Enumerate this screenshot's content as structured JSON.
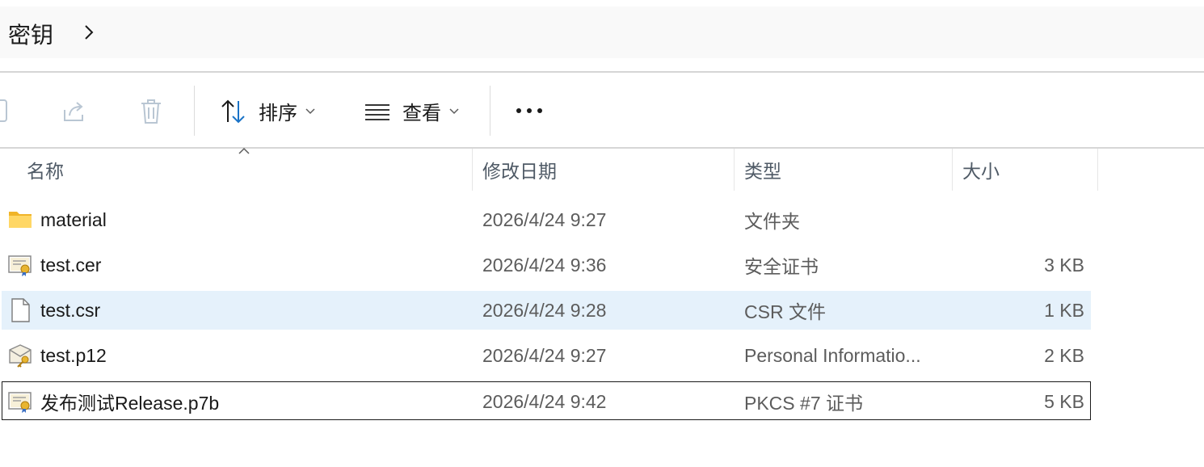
{
  "address_bar": {
    "crumb": "密钥",
    "separator_icon": "chevron-right-icon"
  },
  "toolbar": {
    "sort_label": "排序",
    "view_label": "查看",
    "more_icon": "more-horizontal-icon",
    "icons": [
      "copy-icon",
      "share-icon",
      "delete-icon",
      "sort-icon",
      "view-icon"
    ]
  },
  "columns": {
    "name": "名称",
    "date": "修改日期",
    "type": "类型",
    "size": "大小"
  },
  "files": [
    {
      "name": "material",
      "date": "2026/4/24 9:27",
      "type": "文件夹",
      "size": "",
      "icon": "folder-icon"
    },
    {
      "name": "test.cer",
      "date": "2026/4/24 9:36",
      "type": "安全证书",
      "size": "3 KB",
      "icon": "certificate-icon"
    },
    {
      "name": "test.csr",
      "date": "2026/4/24 9:28",
      "type": "CSR 文件",
      "size": "1 KB",
      "icon": "file-icon",
      "selected": true
    },
    {
      "name": "test.p12",
      "date": "2026/4/24 9:27",
      "type": "Personal Informatio...",
      "size": "2 KB",
      "icon": "personal-cert-icon"
    },
    {
      "name": "发布测试Release.p7b",
      "date": "2026/4/24 9:42",
      "type": "PKCS #7 证书",
      "size": "5 KB",
      "icon": "certificate-icon",
      "focused": true
    }
  ],
  "colors": {
    "selected_row": "#e5f1fb",
    "folder": "#f5c542",
    "accent": "#1a73c7"
  }
}
